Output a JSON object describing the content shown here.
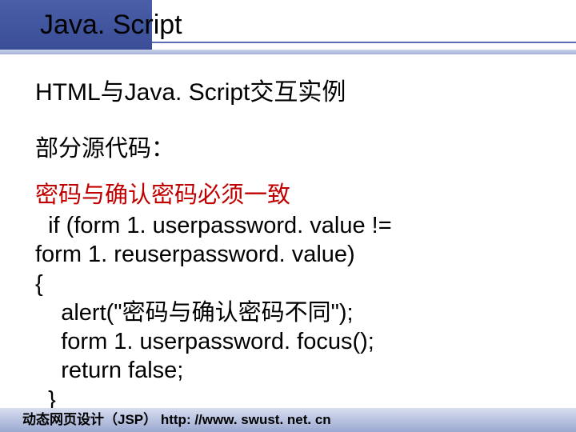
{
  "header": {
    "title": "Java. Script"
  },
  "content": {
    "heading": "HTML与Java. Script交互实例",
    "sub": "部分源代码：",
    "red": "密码与确认密码必须一致",
    "code": {
      "l1": "  if (form 1. userpassword. value != ",
      "l2": "form 1. reuserpassword. value)",
      "l3": "{",
      "l4": "    alert(\"密码与确认密码不同\");",
      "l5": "    form 1. userpassword. focus();",
      "l6": "    return false;",
      "l7": "  }"
    }
  },
  "footer": {
    "text": "动态网页设计（JSP） http: //www. swust. net. cn"
  }
}
